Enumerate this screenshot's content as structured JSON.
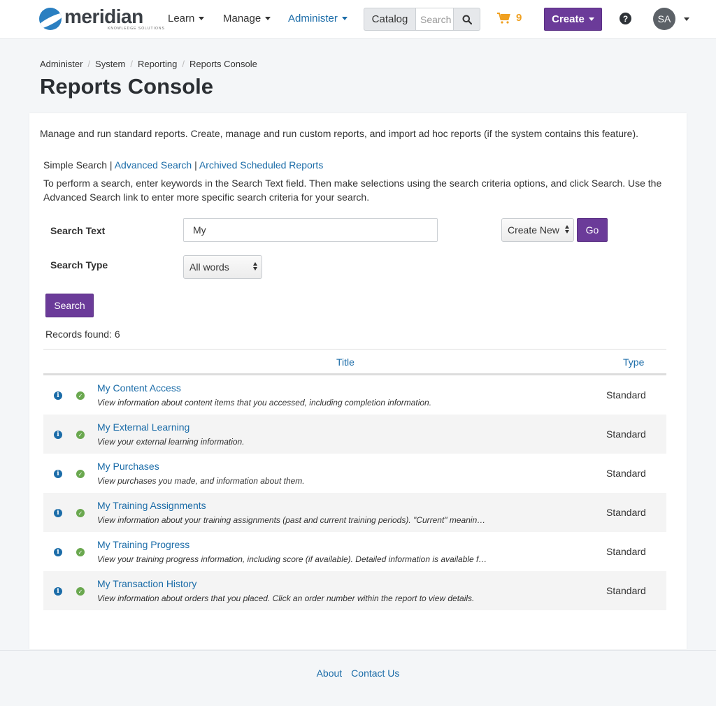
{
  "brand": {
    "name": "meridian",
    "tagline": "KNOWLEDGE SOLUTIONS"
  },
  "nav": {
    "learn": "Learn",
    "manage": "Manage",
    "administer": "Administer",
    "catalog": "Catalog",
    "catalog_search_placeholder": "Search",
    "cart_count": "9",
    "create": "Create",
    "help_glyph": "?",
    "avatar_initials": "SA"
  },
  "breadcrumb": [
    "Administer",
    "System",
    "Reporting",
    "Reports Console"
  ],
  "page_title": "Reports Console",
  "intro": "Manage and run standard reports. Create, manage and run custom reports, and import ad hoc reports (if the system contains this feature).",
  "search_tabs": {
    "simple": "Simple Search",
    "advanced": "Advanced Search",
    "archived": "Archived Scheduled Reports"
  },
  "instructions": "To perform a search, enter keywords in the Search Text field. Then make selections using the search criteria options, and click Search. Use the Advanced Search link to enter more specific search criteria for your search.",
  "form": {
    "search_text_label": "Search Text",
    "search_text_value": "My",
    "search_type_label": "Search Type",
    "search_type_value": "All words",
    "create_new": "Create New",
    "go": "Go",
    "search_button": "Search"
  },
  "records_found": "Records found: 6",
  "table": {
    "headers": {
      "title": "Title",
      "type": "Type"
    },
    "rows": [
      {
        "title": "My Content Access",
        "desc": "View information about content items that you accessed, including completion information.",
        "type": "Standard"
      },
      {
        "title": "My External Learning",
        "desc": "View your external learning information.",
        "type": "Standard"
      },
      {
        "title": "My Purchases",
        "desc": "View purchases you made, and information about them.",
        "type": "Standard"
      },
      {
        "title": "My Training Assignments",
        "desc": "View information about your training assignments (past and current training periods). \"Current\" meaning the current training period.",
        "type": "Standard"
      },
      {
        "title": "My Training Progress",
        "desc": "View your training progress information, including score (if available). Detailed information is available for each item.",
        "type": "Standard"
      },
      {
        "title": "My Transaction History",
        "desc": "View information about orders that you placed. Click an order number within the report to view details.",
        "type": "Standard"
      }
    ]
  },
  "footer": {
    "about": "About",
    "contact": "Contact Us"
  },
  "colors": {
    "accent_purple": "#6b3b99",
    "link_blue": "#1b6ca8",
    "cart_orange": "#f0a020",
    "ok_green": "#6aa84f"
  }
}
